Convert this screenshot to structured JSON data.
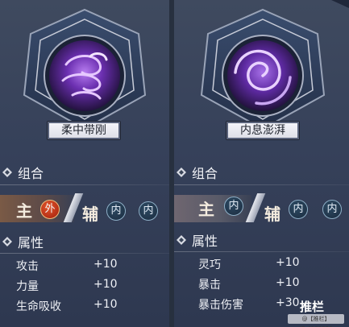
{
  "cards": [
    {
      "name": "柔中带刚",
      "icon": "swirling-wind-icon",
      "combo": {
        "title": "组合",
        "main_label": "主",
        "main_badge": "外",
        "aux_label": "辅",
        "aux_badges": [
          "内",
          "内"
        ]
      },
      "attributes": {
        "title": "属性",
        "items": [
          {
            "label": "攻击",
            "value": "+10"
          },
          {
            "label": "力量",
            "value": "+10"
          },
          {
            "label": "生命吸收",
            "value": "+10"
          }
        ]
      }
    },
    {
      "name": "内息澎湃",
      "icon": "vortex-icon",
      "combo": {
        "title": "组合",
        "main_label": "主",
        "main_badge": "内",
        "aux_label": "辅",
        "aux_badges": [
          "内",
          "内"
        ]
      },
      "attributes": {
        "title": "属性",
        "items": [
          {
            "label": "灵巧",
            "value": "+10"
          },
          {
            "label": "暴击",
            "value": "+10"
          },
          {
            "label": "暴击伤害",
            "value": "+30"
          }
        ]
      }
    }
  ],
  "overlay": {
    "tag": "推栏",
    "watermark": "@【推栏】 ID:4100026"
  },
  "colors": {
    "panel_bg": "#3a4559",
    "badge_outer": "#c9471e",
    "badge_inner": "#1f3248",
    "accent_purple": "#8a4ec8"
  }
}
